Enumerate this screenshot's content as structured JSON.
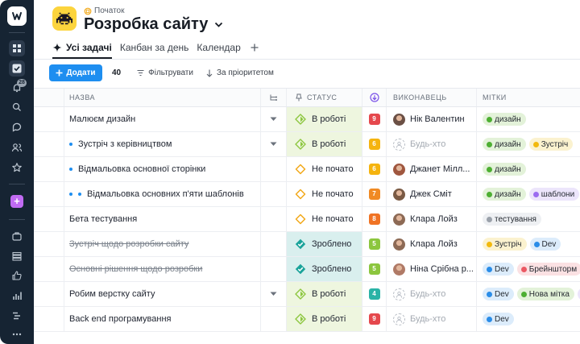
{
  "breadcrumb": {
    "label": "Початок"
  },
  "project": {
    "title": "Розробка сайту"
  },
  "tabs": [
    {
      "label": "Усі задачі"
    },
    {
      "label": "Канбан за день"
    },
    {
      "label": "Календар"
    }
  ],
  "toolbar": {
    "add_label": "Додати",
    "count": "40",
    "filter_label": "Фільтрувати",
    "sort_label": "За пріоритетом"
  },
  "sidebar": {
    "notifications_badge": "28"
  },
  "columns": {
    "name": "НАЗВА",
    "status": "СТАТУС",
    "assignee": "ВИКОНАВЕЦЬ",
    "tags": "МІТКИ"
  },
  "rows": [
    {
      "name": "Малюєм дизайн",
      "indent": 0,
      "expand": true,
      "status": "В роботі",
      "status_kind": "progress",
      "priority": "9",
      "priority_color": "#e5484d",
      "assignee": "Нік Валентин",
      "avatar_color": "#6b5045",
      "tags": [
        {
          "label": "дизайн",
          "color": "green"
        }
      ]
    },
    {
      "name": "Зустріч з керівництвом",
      "indent": 1,
      "expand": true,
      "status": "В роботі",
      "status_kind": "progress",
      "priority": "6",
      "priority_color": "#f5b40f",
      "assignee": "Будь-хто",
      "avatar_color": "",
      "tags": [
        {
          "label": "дизайн",
          "color": "green"
        },
        {
          "label": "Зустріч",
          "color": "yellow"
        }
      ]
    },
    {
      "name": "Відмальовка основної сторінки",
      "indent": 1,
      "expand": false,
      "status": "Не почато",
      "status_kind": "todo",
      "priority": "6",
      "priority_color": "#f5b40f",
      "assignee": "Джанет Мілл...",
      "avatar_color": "#a0573f",
      "tags": [
        {
          "label": "дизайн",
          "color": "green"
        }
      ]
    },
    {
      "name": "Відмальовка основних п'яти шаблонів",
      "indent": 2,
      "expand": false,
      "status": "Не почато",
      "status_kind": "todo",
      "priority": "7",
      "priority_color": "#f08a24",
      "assignee": "Джек Сміт",
      "avatar_color": "#7a5a44",
      "tags": [
        {
          "label": "дизайн",
          "color": "green"
        },
        {
          "label": "шаблони",
          "color": "purple"
        }
      ]
    },
    {
      "name": "Бета тестування",
      "indent": 0,
      "expand": false,
      "status": "Не почато",
      "status_kind": "todo",
      "priority": "8",
      "priority_color": "#f07324",
      "assignee": "Клара Лойз",
      "avatar_color": "#8d6a55",
      "tags": [
        {
          "label": "тестування",
          "color": "gray"
        }
      ]
    },
    {
      "name": "Зустріч щодо розробки сайту",
      "indent": 0,
      "expand": false,
      "struck": true,
      "status": "Зроблено",
      "status_kind": "done",
      "priority": "5",
      "priority_color": "#8cc63e",
      "assignee": "Клара Лойз",
      "avatar_color": "#8d6a55",
      "tags": [
        {
          "label": "Зустріч",
          "color": "yellow"
        },
        {
          "label": "Dev",
          "color": "blue"
        }
      ]
    },
    {
      "name": "Основні рішення щодо розробки",
      "indent": 0,
      "expand": false,
      "struck": true,
      "status": "Зроблено",
      "status_kind": "done",
      "priority": "5",
      "priority_color": "#8cc63e",
      "assignee": "Ніна Срібна р...",
      "avatar_color": "#b07a66",
      "tags": [
        {
          "label": "Dev",
          "color": "blue"
        },
        {
          "label": "Брейншторм",
          "color": "red"
        }
      ]
    },
    {
      "name": "Робим верстку сайту",
      "indent": 0,
      "expand": true,
      "status": "В роботі",
      "status_kind": "progress",
      "priority": "4",
      "priority_color": "#2ab3a6",
      "assignee": "Будь-хто",
      "avatar_color": "",
      "tags": [
        {
          "label": "Dev",
          "color": "blue"
        },
        {
          "label": "Нова мітка",
          "color": "green"
        },
        {
          "label": "Д",
          "color": "purple"
        }
      ]
    },
    {
      "name": "Back end програмування",
      "indent": 0,
      "expand": false,
      "status": "В роботі",
      "status_kind": "progress",
      "priority": "9",
      "priority_color": "#e5484d",
      "assignee": "Будь-хто",
      "avatar_color": "",
      "tags": [
        {
          "label": "Dev",
          "color": "blue"
        }
      ]
    }
  ]
}
